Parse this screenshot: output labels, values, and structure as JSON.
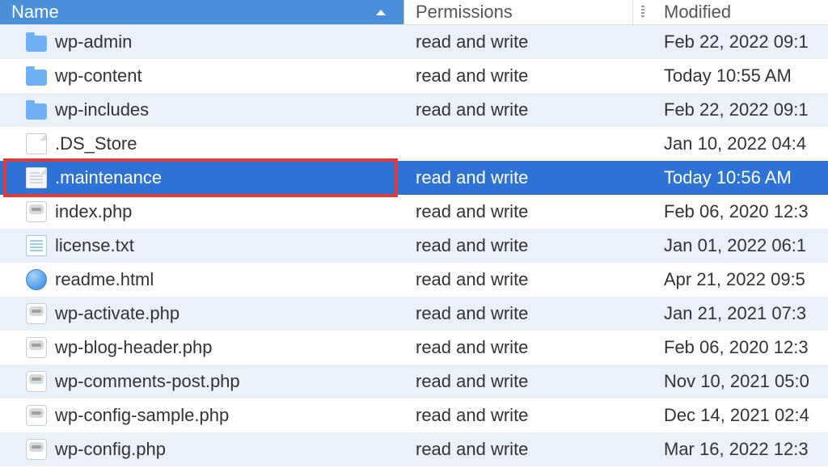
{
  "columns": {
    "name": "Name",
    "permissions": "Permissions",
    "modified": "Modified"
  },
  "files": [
    {
      "name": "wp-admin",
      "permissions": "read and write",
      "modified": "Feb 22, 2022 09:1",
      "icon": "folder",
      "selected": false,
      "highlight": false
    },
    {
      "name": "wp-content",
      "permissions": "read and write",
      "modified": "Today 10:55 AM",
      "icon": "folder",
      "selected": false,
      "highlight": false
    },
    {
      "name": "wp-includes",
      "permissions": "read and write",
      "modified": "Feb 22, 2022 09:1",
      "icon": "folder",
      "selected": false,
      "highlight": false
    },
    {
      "name": ".DS_Store",
      "permissions": "",
      "modified": "Jan 10, 2022 04:4",
      "icon": "doc",
      "selected": false,
      "highlight": false
    },
    {
      "name": ".maintenance",
      "permissions": "read and write",
      "modified": "Today 10:56 AM",
      "icon": "doc-lines",
      "selected": true,
      "highlight": true
    },
    {
      "name": "index.php",
      "permissions": "read and write",
      "modified": "Feb 06, 2020 12:3",
      "icon": "php",
      "selected": false,
      "highlight": false
    },
    {
      "name": "license.txt",
      "permissions": "read and write",
      "modified": "Jan 01, 2022 06:1",
      "icon": "txt",
      "selected": false,
      "highlight": false
    },
    {
      "name": "readme.html",
      "permissions": "read and write",
      "modified": "Apr 21, 2022 09:5",
      "icon": "html",
      "selected": false,
      "highlight": false
    },
    {
      "name": "wp-activate.php",
      "permissions": "read and write",
      "modified": "Jan 21, 2021 07:3",
      "icon": "php",
      "selected": false,
      "highlight": false
    },
    {
      "name": "wp-blog-header.php",
      "permissions": "read and write",
      "modified": "Feb 06, 2020 12:3",
      "icon": "php",
      "selected": false,
      "highlight": false
    },
    {
      "name": "wp-comments-post.php",
      "permissions": "read and write",
      "modified": "Nov 10, 2021 05:0",
      "icon": "php",
      "selected": false,
      "highlight": false
    },
    {
      "name": "wp-config-sample.php",
      "permissions": "read and write",
      "modified": "Dec 14, 2021 02:4",
      "icon": "php",
      "selected": false,
      "highlight": false
    },
    {
      "name": "wp-config.php",
      "permissions": "read and write",
      "modified": "Mar 16, 2022 12:3",
      "icon": "php",
      "selected": false,
      "highlight": false
    }
  ]
}
